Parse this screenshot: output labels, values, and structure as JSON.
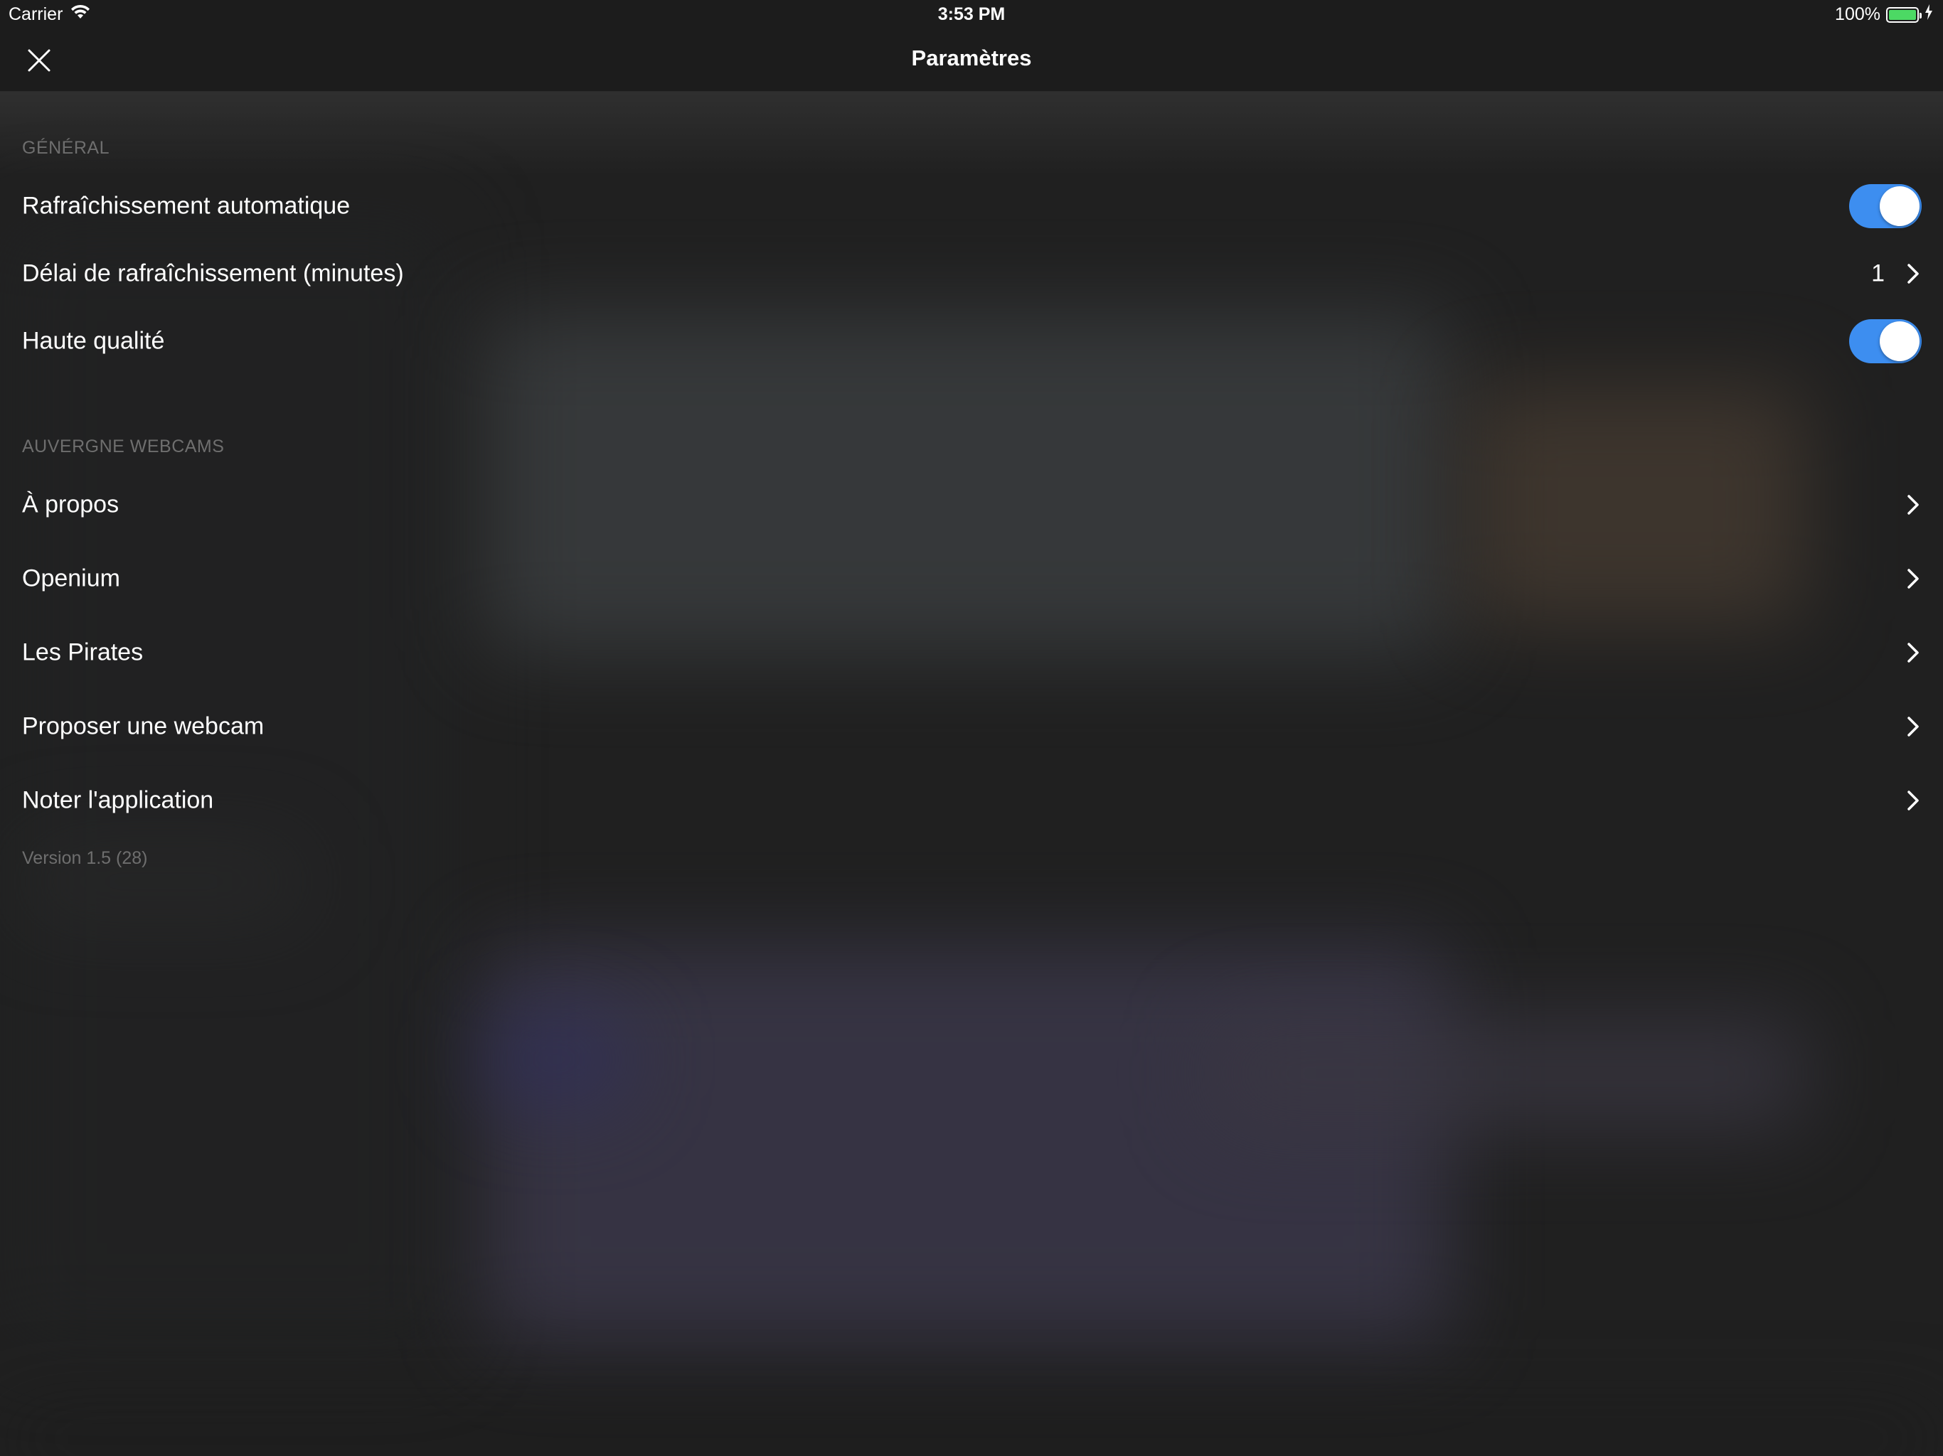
{
  "status_bar": {
    "carrier": "Carrier",
    "time": "3:53 PM",
    "battery_percent": "100%",
    "battery_level": 1.0,
    "wifi_icon": "wifi-icon",
    "charging_icon": "bolt-icon"
  },
  "nav": {
    "title": "Paramètres",
    "close_icon": "close-icon"
  },
  "sections": {
    "general": {
      "header": "GÉNÉRAL",
      "auto_refresh": {
        "label": "Rafraîchissement automatique",
        "enabled": true
      },
      "refresh_delay": {
        "label": "Délai de rafraîchissement (minutes)",
        "value": "1"
      },
      "high_quality": {
        "label": "Haute qualité",
        "enabled": true
      }
    },
    "about": {
      "header": "AUVERGNE WEBCAMS",
      "items": [
        {
          "label": "À propos"
        },
        {
          "label": "Openium"
        },
        {
          "label": "Les Pirates"
        },
        {
          "label": "Proposer une webcam"
        },
        {
          "label": "Noter l'application"
        }
      ]
    }
  },
  "footer": {
    "version": "Version 1.5 (28)"
  },
  "colors": {
    "toggle_on": "#3d8ef0",
    "battery_fill": "#4cd964",
    "background": "#202020",
    "section_header_text": "#6e6e6e"
  }
}
